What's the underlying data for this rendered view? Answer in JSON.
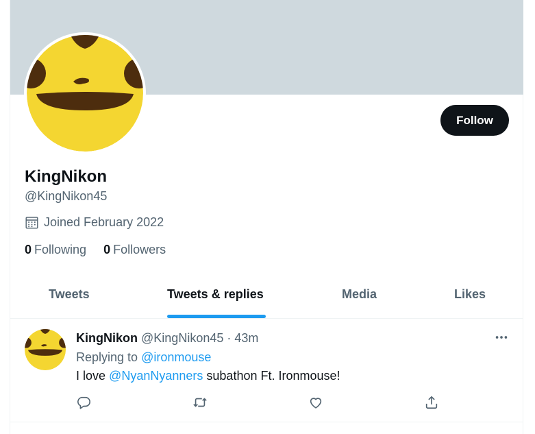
{
  "profile": {
    "name": "KingNikon",
    "handle": "@KingNikon45",
    "joined": "Joined February 2022",
    "following_count": "0",
    "following_label": "Following",
    "followers_count": "0",
    "followers_label": "Followers",
    "follow_label": "Follow"
  },
  "tabs": [
    {
      "label": "Tweets"
    },
    {
      "label": "Tweets & replies"
    },
    {
      "label": "Media"
    },
    {
      "label": "Likes"
    }
  ],
  "tweet": {
    "author": "KingNikon",
    "meta": "@KingNikon45 · 43m",
    "replying_prefix": "Replying to",
    "replying_to": "@ironmouse",
    "text_prefix": "I love",
    "mention": "@NyanNyanners",
    "text_suffix": "subathon Ft. Ironmouse!"
  },
  "icons": {
    "calendar": "calendar-icon",
    "more": "more-icon",
    "reply": "reply-icon",
    "retweet": "retweet-icon",
    "like": "like-icon",
    "share": "share-icon"
  },
  "colors": {
    "accent": "#1d9bf0",
    "banner": "#cfd9de",
    "avatar_yellow": "#f4d631",
    "avatar_brown": "#4d2d0e",
    "follow_button": "#0f1419"
  }
}
